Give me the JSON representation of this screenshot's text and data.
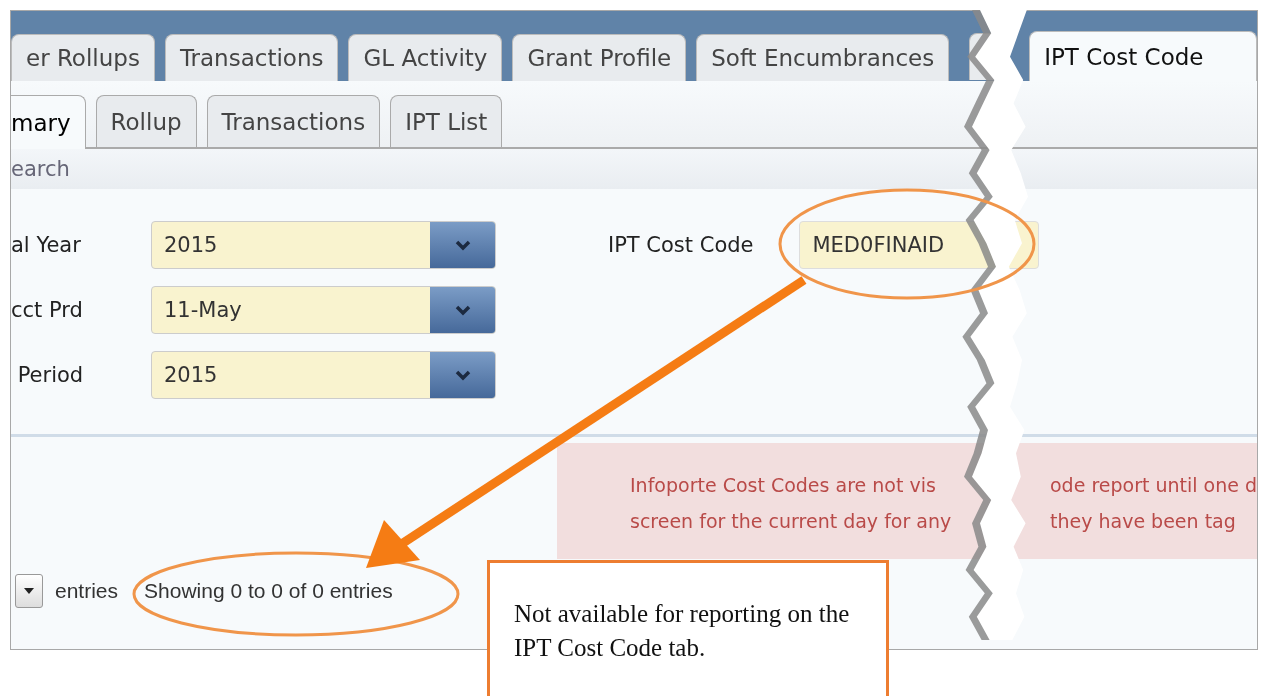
{
  "top_tabs": [
    {
      "label": "er Rollups",
      "selected": false
    },
    {
      "label": "Transactions",
      "selected": false
    },
    {
      "label": "GL Activity",
      "selected": false
    },
    {
      "label": "Grant Profile",
      "selected": false
    },
    {
      "label": "Soft Encumbrances",
      "selected": false
    },
    {
      "label": "IPT Cost Code",
      "selected": true
    }
  ],
  "sub_tabs": [
    {
      "label": "mary",
      "selected": true
    },
    {
      "label": "Rollup",
      "selected": false
    },
    {
      "label": "Transactions",
      "selected": false
    },
    {
      "label": "IPT List",
      "selected": false
    }
  ],
  "section_title": "earch",
  "fields": [
    {
      "label": "al Year",
      "value": "2015"
    },
    {
      "label": "cct Prd",
      "value": "11-May"
    },
    {
      "label": " Period",
      "value": "2015"
    }
  ],
  "cost_code": {
    "label": "IPT Cost Code",
    "value": "MED0FINAID"
  },
  "message": {
    "left_lines": [
      "Infoporte Cost Codes are not vis",
      "screen for the current day for any"
    ],
    "right_lines": [
      "ode report until one d",
      "they have been tag"
    ]
  },
  "length_suffix": "entries",
  "info": "Showing 0 to 0 of 0 entries",
  "callout": "Not available for reporting on the IPT Cost Code tab."
}
